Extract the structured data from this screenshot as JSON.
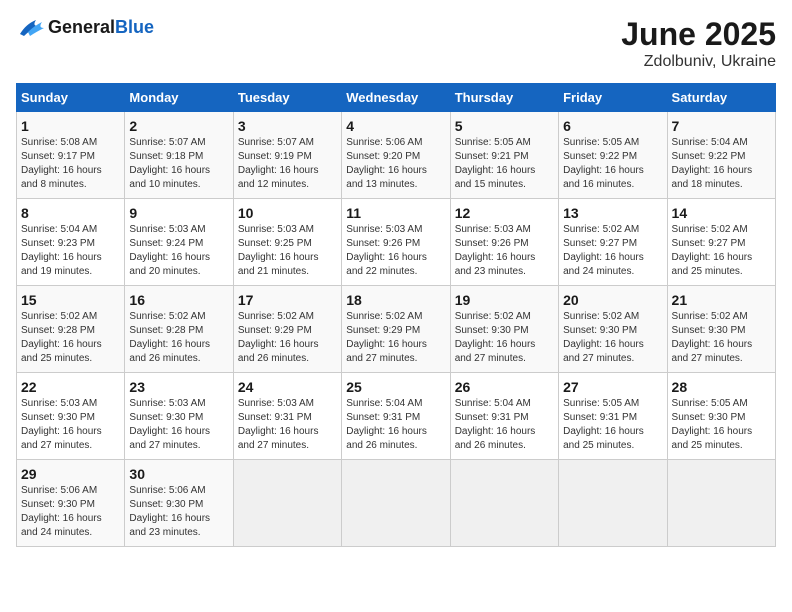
{
  "logo": {
    "general": "General",
    "blue": "Blue"
  },
  "title": "June 2025",
  "subtitle": "Zdolbuniv, Ukraine",
  "days_header": [
    "Sunday",
    "Monday",
    "Tuesday",
    "Wednesday",
    "Thursday",
    "Friday",
    "Saturday"
  ],
  "weeks": [
    [
      {
        "day": "1",
        "sunrise": "Sunrise: 5:08 AM",
        "sunset": "Sunset: 9:17 PM",
        "daylight": "Daylight: 16 hours and 8 minutes."
      },
      {
        "day": "2",
        "sunrise": "Sunrise: 5:07 AM",
        "sunset": "Sunset: 9:18 PM",
        "daylight": "Daylight: 16 hours and 10 minutes."
      },
      {
        "day": "3",
        "sunrise": "Sunrise: 5:07 AM",
        "sunset": "Sunset: 9:19 PM",
        "daylight": "Daylight: 16 hours and 12 minutes."
      },
      {
        "day": "4",
        "sunrise": "Sunrise: 5:06 AM",
        "sunset": "Sunset: 9:20 PM",
        "daylight": "Daylight: 16 hours and 13 minutes."
      },
      {
        "day": "5",
        "sunrise": "Sunrise: 5:05 AM",
        "sunset": "Sunset: 9:21 PM",
        "daylight": "Daylight: 16 hours and 15 minutes."
      },
      {
        "day": "6",
        "sunrise": "Sunrise: 5:05 AM",
        "sunset": "Sunset: 9:22 PM",
        "daylight": "Daylight: 16 hours and 16 minutes."
      },
      {
        "day": "7",
        "sunrise": "Sunrise: 5:04 AM",
        "sunset": "Sunset: 9:22 PM",
        "daylight": "Daylight: 16 hours and 18 minutes."
      }
    ],
    [
      {
        "day": "8",
        "sunrise": "Sunrise: 5:04 AM",
        "sunset": "Sunset: 9:23 PM",
        "daylight": "Daylight: 16 hours and 19 minutes."
      },
      {
        "day": "9",
        "sunrise": "Sunrise: 5:03 AM",
        "sunset": "Sunset: 9:24 PM",
        "daylight": "Daylight: 16 hours and 20 minutes."
      },
      {
        "day": "10",
        "sunrise": "Sunrise: 5:03 AM",
        "sunset": "Sunset: 9:25 PM",
        "daylight": "Daylight: 16 hours and 21 minutes."
      },
      {
        "day": "11",
        "sunrise": "Sunrise: 5:03 AM",
        "sunset": "Sunset: 9:26 PM",
        "daylight": "Daylight: 16 hours and 22 minutes."
      },
      {
        "day": "12",
        "sunrise": "Sunrise: 5:03 AM",
        "sunset": "Sunset: 9:26 PM",
        "daylight": "Daylight: 16 hours and 23 minutes."
      },
      {
        "day": "13",
        "sunrise": "Sunrise: 5:02 AM",
        "sunset": "Sunset: 9:27 PM",
        "daylight": "Daylight: 16 hours and 24 minutes."
      },
      {
        "day": "14",
        "sunrise": "Sunrise: 5:02 AM",
        "sunset": "Sunset: 9:27 PM",
        "daylight": "Daylight: 16 hours and 25 minutes."
      }
    ],
    [
      {
        "day": "15",
        "sunrise": "Sunrise: 5:02 AM",
        "sunset": "Sunset: 9:28 PM",
        "daylight": "Daylight: 16 hours and 25 minutes."
      },
      {
        "day": "16",
        "sunrise": "Sunrise: 5:02 AM",
        "sunset": "Sunset: 9:28 PM",
        "daylight": "Daylight: 16 hours and 26 minutes."
      },
      {
        "day": "17",
        "sunrise": "Sunrise: 5:02 AM",
        "sunset": "Sunset: 9:29 PM",
        "daylight": "Daylight: 16 hours and 26 minutes."
      },
      {
        "day": "18",
        "sunrise": "Sunrise: 5:02 AM",
        "sunset": "Sunset: 9:29 PM",
        "daylight": "Daylight: 16 hours and 27 minutes."
      },
      {
        "day": "19",
        "sunrise": "Sunrise: 5:02 AM",
        "sunset": "Sunset: 9:30 PM",
        "daylight": "Daylight: 16 hours and 27 minutes."
      },
      {
        "day": "20",
        "sunrise": "Sunrise: 5:02 AM",
        "sunset": "Sunset: 9:30 PM",
        "daylight": "Daylight: 16 hours and 27 minutes."
      },
      {
        "day": "21",
        "sunrise": "Sunrise: 5:02 AM",
        "sunset": "Sunset: 9:30 PM",
        "daylight": "Daylight: 16 hours and 27 minutes."
      }
    ],
    [
      {
        "day": "22",
        "sunrise": "Sunrise: 5:03 AM",
        "sunset": "Sunset: 9:30 PM",
        "daylight": "Daylight: 16 hours and 27 minutes."
      },
      {
        "day": "23",
        "sunrise": "Sunrise: 5:03 AM",
        "sunset": "Sunset: 9:30 PM",
        "daylight": "Daylight: 16 hours and 27 minutes."
      },
      {
        "day": "24",
        "sunrise": "Sunrise: 5:03 AM",
        "sunset": "Sunset: 9:31 PM",
        "daylight": "Daylight: 16 hours and 27 minutes."
      },
      {
        "day": "25",
        "sunrise": "Sunrise: 5:04 AM",
        "sunset": "Sunset: 9:31 PM",
        "daylight": "Daylight: 16 hours and 26 minutes."
      },
      {
        "day": "26",
        "sunrise": "Sunrise: 5:04 AM",
        "sunset": "Sunset: 9:31 PM",
        "daylight": "Daylight: 16 hours and 26 minutes."
      },
      {
        "day": "27",
        "sunrise": "Sunrise: 5:05 AM",
        "sunset": "Sunset: 9:31 PM",
        "daylight": "Daylight: 16 hours and 25 minutes."
      },
      {
        "day": "28",
        "sunrise": "Sunrise: 5:05 AM",
        "sunset": "Sunset: 9:30 PM",
        "daylight": "Daylight: 16 hours and 25 minutes."
      }
    ],
    [
      {
        "day": "29",
        "sunrise": "Sunrise: 5:06 AM",
        "sunset": "Sunset: 9:30 PM",
        "daylight": "Daylight: 16 hours and 24 minutes."
      },
      {
        "day": "30",
        "sunrise": "Sunrise: 5:06 AM",
        "sunset": "Sunset: 9:30 PM",
        "daylight": "Daylight: 16 hours and 23 minutes."
      },
      null,
      null,
      null,
      null,
      null
    ]
  ]
}
